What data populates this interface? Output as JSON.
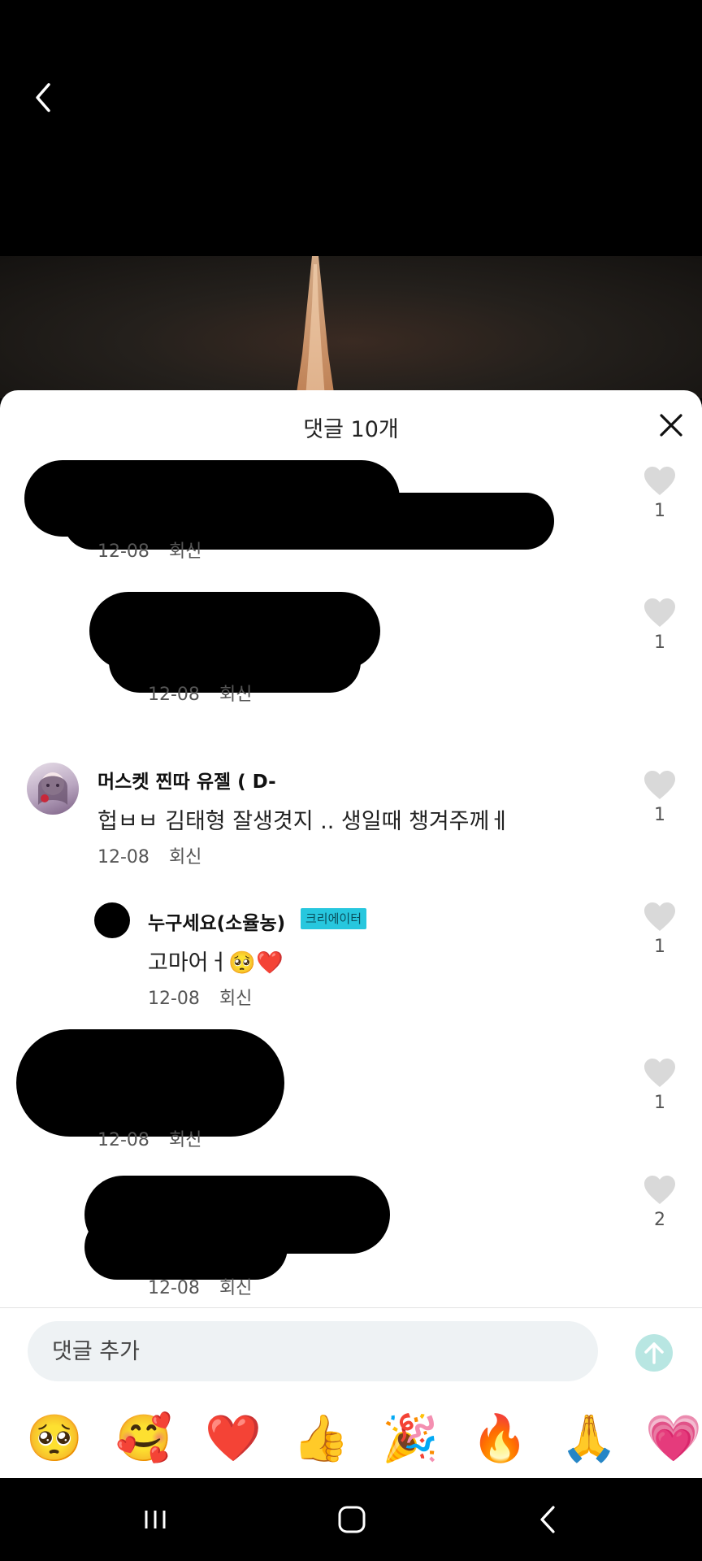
{
  "sheet": {
    "title": "댓글 10개"
  },
  "comments": [
    {
      "author": "",
      "text": "",
      "date": "12-08",
      "reply": "회신",
      "likes": "1",
      "redacted": true
    },
    {
      "author": "",
      "text": "",
      "date": "12-08",
      "reply": "회신",
      "likes": "1",
      "redacted": true
    },
    {
      "author": "머스켓 찐따 유젤 ( D-",
      "text": "헙ㅂㅂ 김태형 잘생겻지 .. 생일때 챙겨주께ㅔ",
      "date": "12-08",
      "reply": "회신",
      "likes": "1"
    },
    {
      "author": "누구세요(소율농)",
      "badge": "크리에이터",
      "text": "고마어ㅓ🥺❤️",
      "date": "12-08",
      "reply": "회신",
      "likes": "1"
    },
    {
      "author": "",
      "text": "",
      "date": "12-08",
      "reply": "회신",
      "likes": "1",
      "redacted": true
    },
    {
      "author": "",
      "text": "",
      "date": "12-08",
      "reply": "회신",
      "likes": "2",
      "redacted": true
    }
  ],
  "input": {
    "placeholder": "댓글 추가"
  },
  "emojis": [
    "🥺",
    "🥰",
    "❤️",
    "👍",
    "🎉",
    "🔥",
    "🙏",
    "💗"
  ],
  "colors": {
    "sheet_bg": "#ffffff",
    "badge": "#27c7de",
    "send_button": "#b8e6e2",
    "input_bg": "#eef2f4",
    "heart": "#d9d9d9"
  }
}
